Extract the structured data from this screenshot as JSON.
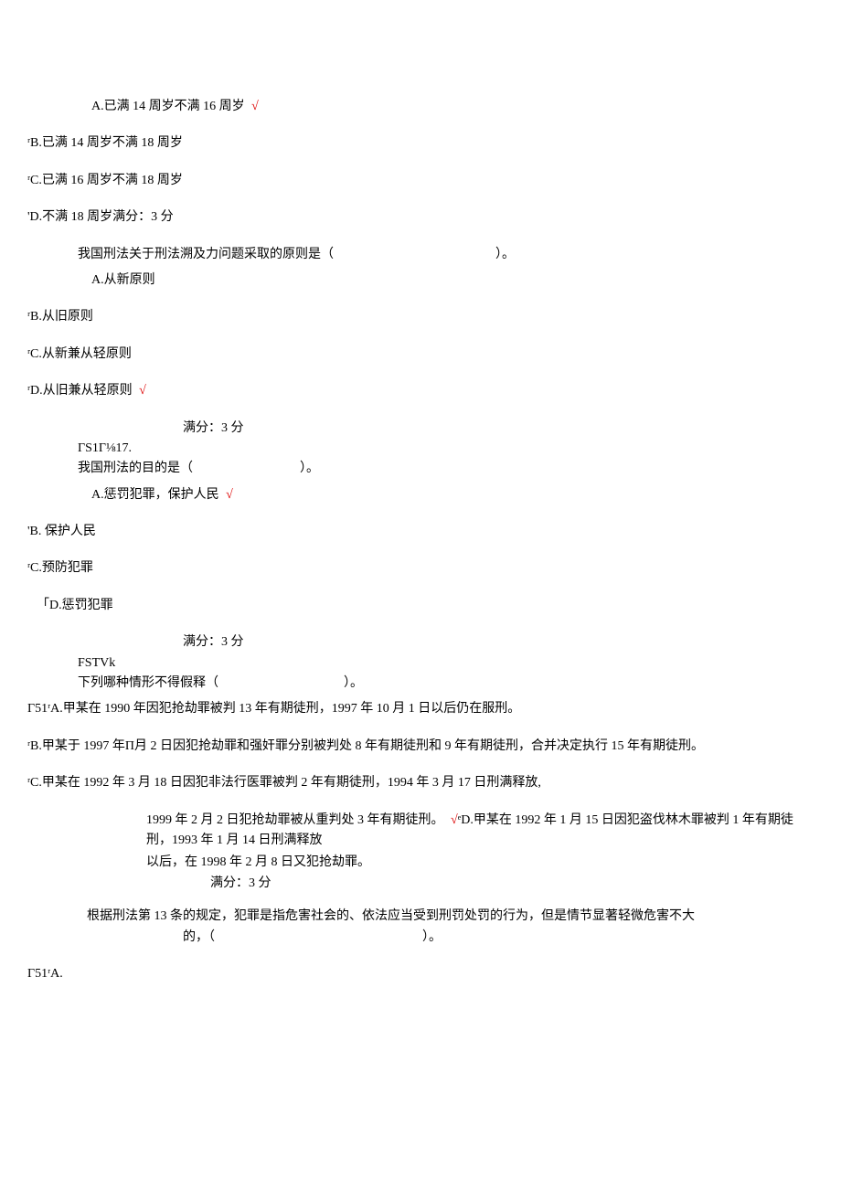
{
  "q15": {
    "optA": "A.已满 14 周岁不满 16 周岁",
    "checkA": "√",
    "optB": "ʳB.已满 14 周岁不满 18 周岁",
    "optC": "ʳC.已满 16 周岁不满 18 周岁",
    "optD": "'D.不满 18 周岁满分：3 分"
  },
  "q16": {
    "stem_pre": "我国刑法关于刑法溯及力问题采取的原则是（",
    "stem_post": "）。",
    "optA": "A.从新原则",
    "optB": "ʳB.从旧原则",
    "optC": "ʳC.从新兼从轻原则",
    "optD": "ʳD.从旧兼从轻原则",
    "checkD": "√",
    "score": "满分：3 分",
    "code": "ΓS1Γ⅛17."
  },
  "q17": {
    "stem_pre": "我国刑法的目的是（",
    "stem_post": "）。",
    "optA": "A.惩罚犯罪，保护人民",
    "checkA": "√",
    "optB": "'B. 保护人民",
    "optC": "ʳC.预防犯罪",
    "optD": "「D.惩罚犯罪",
    "score": "满分：3 分",
    "code": "FSTVk"
  },
  "q18": {
    "stem_pre": "下列哪种情形不得假释（",
    "stem_post": "）。",
    "optA": "Γ51ʳA.甲某在 1990 年因犯抢劫罪被判 13 年有期徒刑，1997 年 10 月 1 日以后仍在服刑。",
    "optB": "ʳB.甲某于 1997 年Π月 2 日因犯抢劫罪和强奸罪分别被判处 8 年有期徒刑和 9 年有期徒刑，合并决定执行 15 年有期徒刑。",
    "optC": "ʳC.甲某在 1992 年 3 月 18 日因犯非法行医罪被判 2 年有期徒刑，1994 年 3 月 17 日刑满释放,",
    "optC2_pre": "1999 年 2 月 2 日犯抢劫罪被从重判处 3 年有期徒刑。",
    "checkC": "√",
    "optD_pre": "ᵉD.甲某在 1992 年 1 月 15 日因犯盗伐林木罪被判 1 年有期徒刑，1993 年 1 月 14 日刑满释放",
    "optD_2": "以后，在 1998 年 2 月 8 日又犯抢劫罪。",
    "score": "满分：3 分"
  },
  "q19": {
    "stem_l1": "根据刑法第 13 条的规定，犯罪是指危害社会的、依法应当受到刑罚处罚的行为，但是情节显著轻微危害不大",
    "stem_l2_pre": "的，（",
    "stem_l2_post": "）。",
    "optA": "Γ51ʳA."
  }
}
